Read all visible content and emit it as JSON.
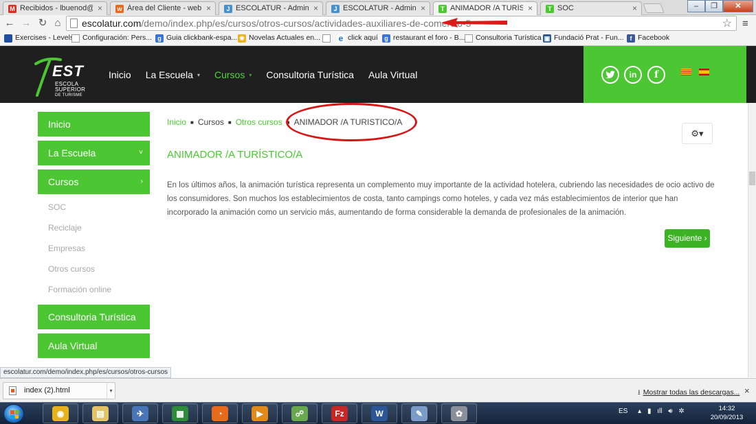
{
  "browser": {
    "tabs": [
      {
        "label": "Recibidos - lbuenod@gm",
        "icon": "gmail-icon",
        "color": "#d93025",
        "glyph": "M"
      },
      {
        "label": "Área del Cliente - webemp",
        "icon": "webempresa-icon",
        "color": "#e36b22",
        "glyph": "w"
      },
      {
        "label": "ESCOLATUR - Administra",
        "icon": "joomla-icon",
        "color": "#4a90c9",
        "glyph": "J"
      },
      {
        "label": "ESCOLATUR - Administra",
        "icon": "joomla-icon",
        "color": "#4a90c9",
        "glyph": "J"
      },
      {
        "label": "ANIMADOR /A TURÍSTICO",
        "icon": "test-logo-icon",
        "color": "#4cc733",
        "glyph": "T"
      },
      {
        "label": "SOC",
        "icon": "test-logo-icon",
        "color": "#4cc733",
        "glyph": "T"
      }
    ],
    "url_host": "escolatur.com",
    "url_path": "/demo/index.php/es/cursos/otros-cursos/actividades-auxiliares-de-comercio-5",
    "bookmarks": [
      {
        "label": "Exercises - Levels",
        "icon": "uk-flag-icon",
        "color": "#1e4fa3",
        "glyph": ""
      },
      {
        "label": "Configuración: Pers...",
        "icon": "page-icon",
        "color": "#ffffff",
        "glyph": ""
      },
      {
        "label": "Guia clickbank-espa...",
        "icon": "google-icon",
        "color": "#3b74d6",
        "glyph": "g"
      },
      {
        "label": "Novelas Actuales en...",
        "icon": "sun-icon",
        "color": "#f0b21a",
        "glyph": "✹"
      },
      {
        "label": "",
        "icon": "page-icon",
        "color": "#ffffff",
        "glyph": ""
      },
      {
        "label": "click aquí",
        "icon": "ie-icon",
        "color": "#1d6fd8",
        "glyph": "e"
      },
      {
        "label": "restaurant el foro - B...",
        "icon": "google-icon",
        "color": "#3b74d6",
        "glyph": "g"
      },
      {
        "label": "Consultoria Turística",
        "icon": "page-icon",
        "color": "#ffffff",
        "glyph": ""
      },
      {
        "label": "Fundació Prat - Fun...",
        "icon": "building-icon",
        "color": "#2d5a8c",
        "glyph": "▣"
      },
      {
        "label": "Facebook",
        "icon": "facebook-icon",
        "color": "#3b5998",
        "glyph": "f"
      }
    ],
    "status_url": "escolatur.com/demo/index.php/es/cursos/otros-cursos"
  },
  "site": {
    "logo": {
      "brand": "EST",
      "line1": "ESCOLA",
      "line2": "SUPERIOR",
      "line3": "DE TURISME"
    },
    "nav": [
      {
        "label": "Inicio",
        "caret": ""
      },
      {
        "label": "La Escuela",
        "caret": "▾"
      },
      {
        "label": "Cursos",
        "caret": "▾"
      },
      {
        "label": "Consultoria Turística",
        "caret": ""
      },
      {
        "label": "Aula Virtual",
        "caret": ""
      }
    ],
    "social": [
      {
        "name": "twitter-icon",
        "glyph": "t"
      },
      {
        "name": "linkedin-icon",
        "glyph": "in"
      },
      {
        "name": "facebook-icon",
        "glyph": "f"
      }
    ],
    "accent_color": "#4cc733"
  },
  "sidebar": {
    "top_buttons": [
      {
        "label": "Inicio",
        "chev": ""
      },
      {
        "label": "La Escuela",
        "chev": "˅"
      },
      {
        "label": "Cursos",
        "chev": "›"
      }
    ],
    "sublinks": [
      "SOC",
      "Reciclaje",
      "Empresas",
      "Otros cursos",
      "Formación online"
    ],
    "bottom_buttons": [
      {
        "label": "Consultoria Turística"
      },
      {
        "label": "Aula Virtual"
      }
    ]
  },
  "content": {
    "breadcrumb": [
      "Inicio",
      "Cursos",
      "Otros cursos",
      "ANIMADOR /A TURISTICO/A"
    ],
    "gear_label": "⚙▾",
    "title": "ANIMADOR /A TURÍSTICO/A",
    "body": "En los últimos años, la animación turística representa un complemento muy importante de la actividad hotelera, cubriendo las necesidades de ocio activo de los consumidores. Son muchos los establecimientos de costa, tanto campings como hoteles, y cada vez más establecimientos de interior que han incorporado la animación como un servicio más, aumentando de forma considerable la demanda de profesionales de la animación.",
    "next_label": "Siguiente ›"
  },
  "downloads": {
    "file": "index (2).html",
    "show_all": "Mostrar todas las descargas..."
  },
  "taskbar": {
    "apps": [
      {
        "name": "chrome-icon",
        "color": "#e8b21d",
        "glyph": "◉"
      },
      {
        "name": "file-explorer-icon",
        "color": "#e3c36a",
        "glyph": "▤"
      },
      {
        "name": "satellite-app-icon",
        "color": "#4876b6",
        "glyph": "✈"
      },
      {
        "name": "spreadsheet-app-icon",
        "color": "#2f8a3a",
        "glyph": "▦"
      },
      {
        "name": "firefox-icon",
        "color": "#e76b1c",
        "glyph": "◔"
      },
      {
        "name": "media-player-icon",
        "color": "#e08a1c",
        "glyph": "▶"
      },
      {
        "name": "network-app-icon",
        "color": "#6aa84f",
        "glyph": "☍"
      },
      {
        "name": "filezilla-icon",
        "color": "#c62828",
        "glyph": "Fz"
      },
      {
        "name": "word-icon",
        "color": "#2b5797",
        "glyph": "W"
      },
      {
        "name": "notepad-icon",
        "color": "#7a9cc6",
        "glyph": "✎"
      },
      {
        "name": "paint-icon",
        "color": "#8a8f99",
        "glyph": "✿"
      }
    ],
    "lang": "ES",
    "time": "14:32",
    "date": "20/09/2013"
  }
}
